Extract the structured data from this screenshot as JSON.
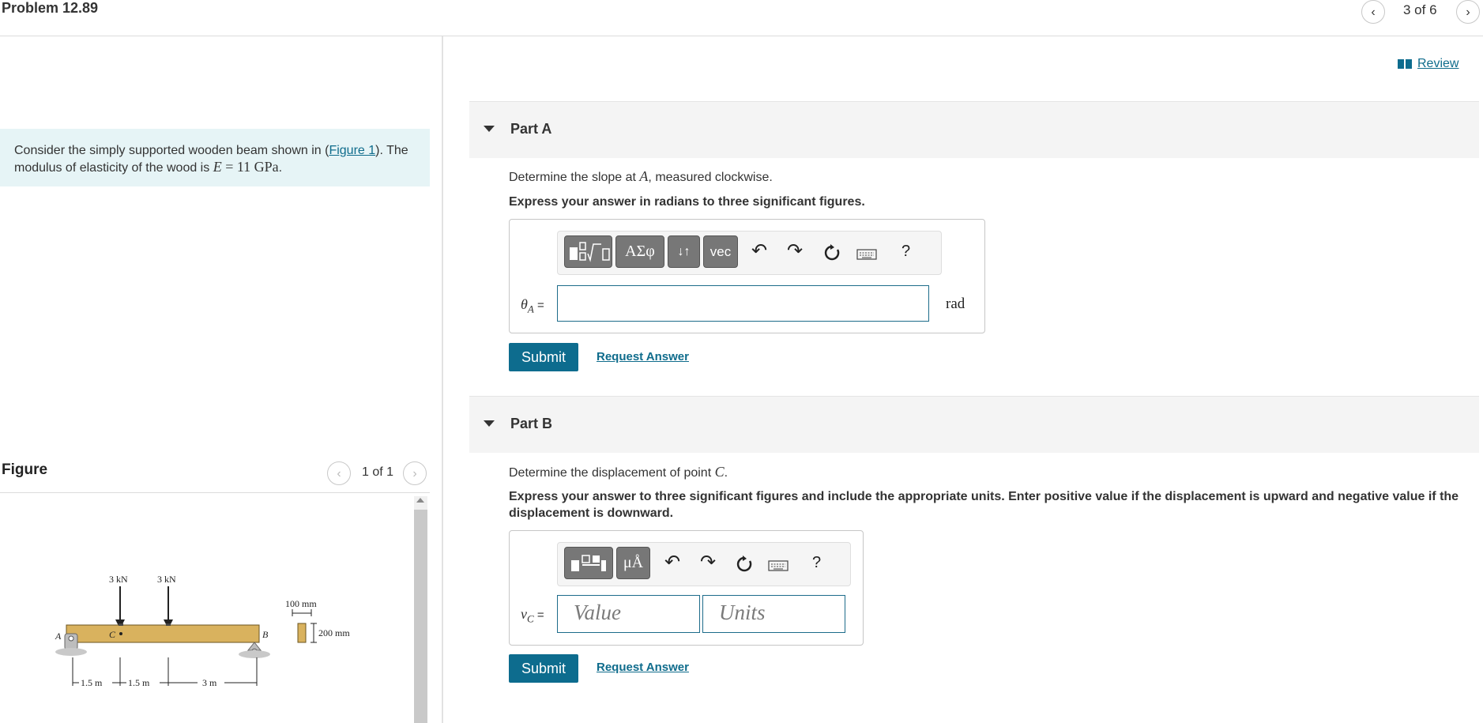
{
  "header": {
    "problem_title": "Problem 12.89",
    "pager": "3 of 6",
    "prev_icon": "chevron-left-icon",
    "next_icon": "chevron-right-icon"
  },
  "intro": {
    "text_before": "Consider the simply supported wooden beam shown in (",
    "figure_link": "Figure 1",
    "text_mid": "). The modulus of elasticity of the wood is ",
    "E_symbol": "E",
    "E_value": " = 11 GPa",
    "text_end": "."
  },
  "figure": {
    "heading": "Figure",
    "pager": "1 of 1",
    "labels": {
      "load1": "3 kN",
      "load2": "3 kN",
      "width": "100 mm",
      "height": "200 mm",
      "pointA": "A",
      "pointB": "B",
      "pointC": "C",
      "dim1": "1.5 m",
      "dim2": "1.5 m",
      "dim3": "3 m"
    }
  },
  "review": {
    "label": "Review"
  },
  "partA": {
    "title": "Part A",
    "prompt_before": "Determine the slope at ",
    "prompt_var": "A",
    "prompt_after": ", measured clockwise.",
    "instructions": "Express your answer in radians to three significant figures.",
    "answer_label_var": "θ",
    "answer_label_sub": "A",
    "answer_label_eq": " =",
    "input_value": "",
    "unit": "rad",
    "toolbar": {
      "templates": "templates",
      "greek": "ΑΣφ",
      "sort": "↓↑",
      "vec": "vec",
      "help": "?"
    },
    "submit": "Submit",
    "request": "Request Answer"
  },
  "partB": {
    "title": "Part B",
    "prompt_before": "Determine the displacement of point ",
    "prompt_var": "C",
    "prompt_after": ".",
    "instructions": "Express your answer to three significant figures and include the appropriate units. Enter positive value if the displacement is upward and negative value if the displacement is downward.",
    "answer_label_var": "v",
    "answer_label_sub": "C",
    "answer_label_eq": " =",
    "value_placeholder": "Value",
    "units_placeholder": "Units",
    "toolbar": {
      "units": "μÅ",
      "help": "?"
    },
    "submit": "Submit",
    "request": "Request Answer"
  },
  "colors": {
    "accent": "#0d6c8e",
    "intro_bg": "#e6f4f6",
    "beam": "#d9b25e"
  }
}
